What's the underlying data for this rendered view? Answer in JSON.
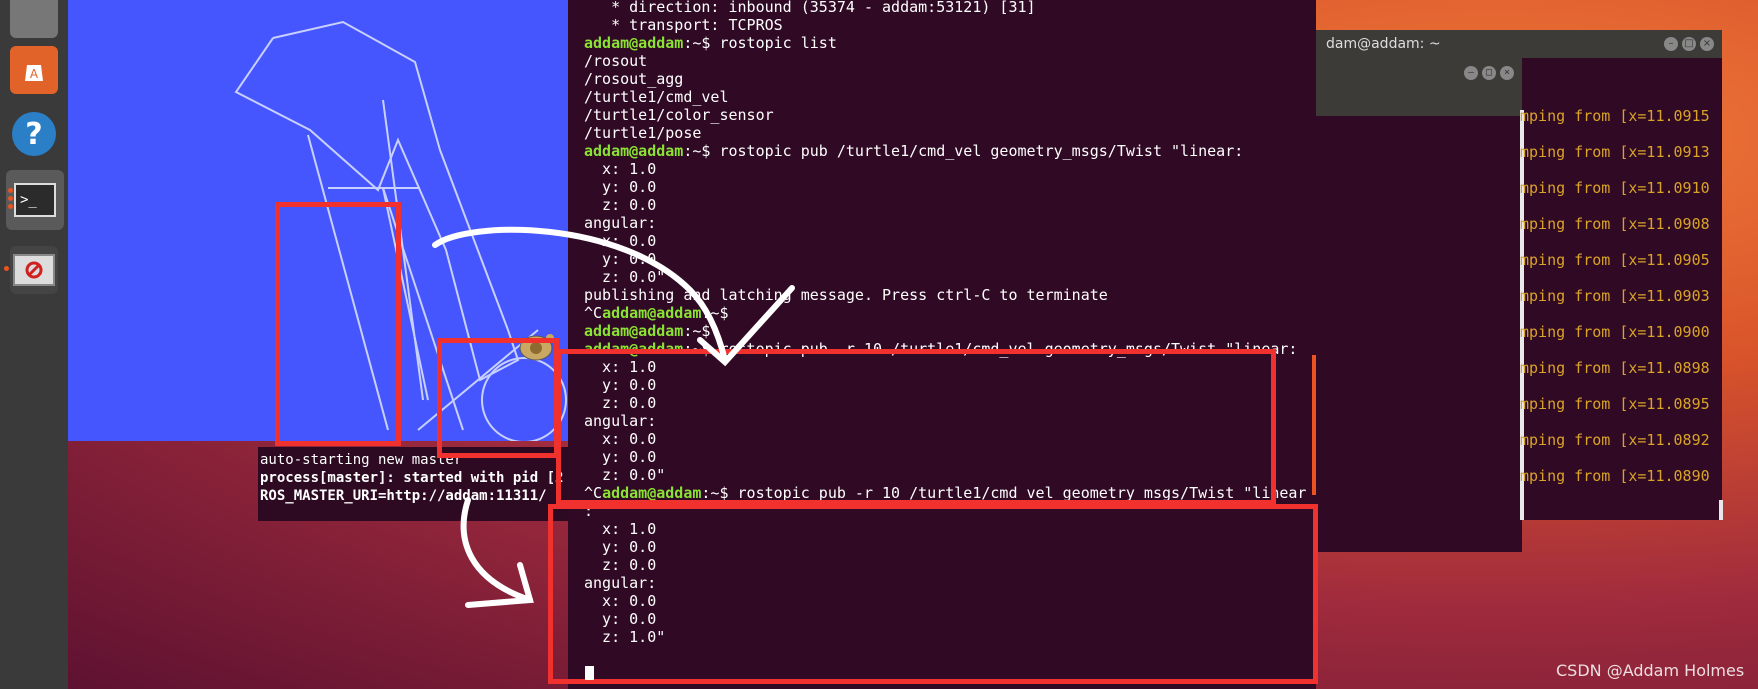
{
  "launcher": {
    "items": [
      "files-icon",
      "software-store-icon",
      "help-icon",
      "terminal-icon",
      "turtlesim-icon"
    ]
  },
  "master_terminal": {
    "lines": [
      "auto-starting new master",
      "process[master]: started with pid [2",
      "ROS_MASTER_URI=http://addam:11311/"
    ]
  },
  "right_terminal": {
    "title": "dam@addam: ~",
    "log_lines": [
      "mping from [x=11.0915",
      "mping from [x=11.0913",
      "mping from [x=11.0910",
      "mping from [x=11.0908",
      "mping from [x=11.0905",
      "mping from [x=11.0903",
      "mping from [x=11.0900",
      "mping from [x=11.0898",
      "mping from [x=11.0895",
      "mping from [x=11.0892",
      "mping from [x=11.0890"
    ]
  },
  "main_terminal": {
    "prompt": "addam@addam",
    "lines": [
      {
        "text": "   * direction: inbound (35374 - addam:53121) [31]"
      },
      {
        "text": "   * transport: TCPROS"
      },
      {
        "prompt": true,
        "text": ":~$ rostopic list"
      },
      {
        "text": "/rosout"
      },
      {
        "text": "/rosout_agg"
      },
      {
        "text": "/turtle1/cmd_vel"
      },
      {
        "text": "/turtle1/color_sensor"
      },
      {
        "text": "/turtle1/pose"
      },
      {
        "prompt": true,
        "text": ":~$ rostopic pub /turtle1/cmd_vel geometry_msgs/Twist \"linear:"
      },
      {
        "text": "  x: 1.0"
      },
      {
        "text": "  y: 0.0"
      },
      {
        "text": "  z: 0.0"
      },
      {
        "text": "angular:"
      },
      {
        "text": "  x: 0.0"
      },
      {
        "text": "  y: 0.0"
      },
      {
        "text": "  z: 0.0\""
      },
      {
        "text": "publishing and latching message. Press ctrl-C to terminate"
      },
      {
        "pre": "^C",
        "prompt": true,
        "text": ":~$"
      },
      {
        "prompt": true,
        "text": ":~$"
      },
      {
        "prompt": true,
        "text": ":~$ rostopic pub -r 10 /turtle1/cmd_vel geometry_msgs/Twist \"linear:"
      },
      {
        "text": "  x: 1.0"
      },
      {
        "text": "  y: 0.0"
      },
      {
        "text": "  z: 0.0"
      },
      {
        "text": "angular:"
      },
      {
        "text": "  x: 0.0"
      },
      {
        "text": "  y: 0.0"
      },
      {
        "text": "  z: 0.0\""
      },
      {
        "pre": "^C",
        "prompt": true,
        "text": ":~$ rostopic pub -r 10 /turtle1/cmd_vel geometry_msgs/Twist \"linear"
      },
      {
        "text": ":"
      },
      {
        "text": "  x: 1.0"
      },
      {
        "text": "  y: 0.0"
      },
      {
        "text": "  z: 0.0"
      },
      {
        "text": "angular:"
      },
      {
        "text": "  x: 0.0"
      },
      {
        "text": "  y: 0.0"
      },
      {
        "text": "  z: 1.0\""
      }
    ]
  },
  "watermark": "CSDN @Addam Holmes",
  "colors": {
    "terminal_bg": "#300a24",
    "prompt_green": "#8ae234",
    "turtlesim_bg": "#4656ff",
    "annotation_red": "#f0312e",
    "log_yellow": "#d9a328"
  }
}
